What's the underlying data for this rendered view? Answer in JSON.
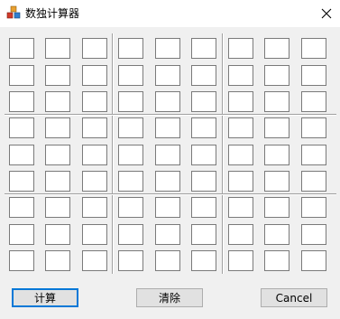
{
  "window": {
    "title": "数独计算器"
  },
  "grid": {
    "rows": 9,
    "cols": 9,
    "values": [
      [
        "",
        "",
        "",
        "",
        "",
        "",
        "",
        "",
        ""
      ],
      [
        "",
        "",
        "",
        "",
        "",
        "",
        "",
        "",
        ""
      ],
      [
        "",
        "",
        "",
        "",
        "",
        "",
        "",
        "",
        ""
      ],
      [
        "",
        "",
        "",
        "",
        "",
        "",
        "",
        "",
        ""
      ],
      [
        "",
        "",
        "",
        "",
        "",
        "",
        "",
        "",
        ""
      ],
      [
        "",
        "",
        "",
        "",
        "",
        "",
        "",
        "",
        ""
      ],
      [
        "",
        "",
        "",
        "",
        "",
        "",
        "",
        "",
        ""
      ],
      [
        "",
        "",
        "",
        "",
        "",
        "",
        "",
        "",
        ""
      ],
      [
        "",
        "",
        "",
        "",
        "",
        "",
        "",
        "",
        ""
      ]
    ]
  },
  "buttons": {
    "calculate_label": "计算",
    "clear_label": "清除",
    "cancel_label": "Cancel"
  },
  "icons": {
    "app": "app-cubes-icon",
    "close": "close-icon"
  },
  "colors": {
    "default_button_border": "#0078d7",
    "window_background": "#f0f0f0"
  }
}
